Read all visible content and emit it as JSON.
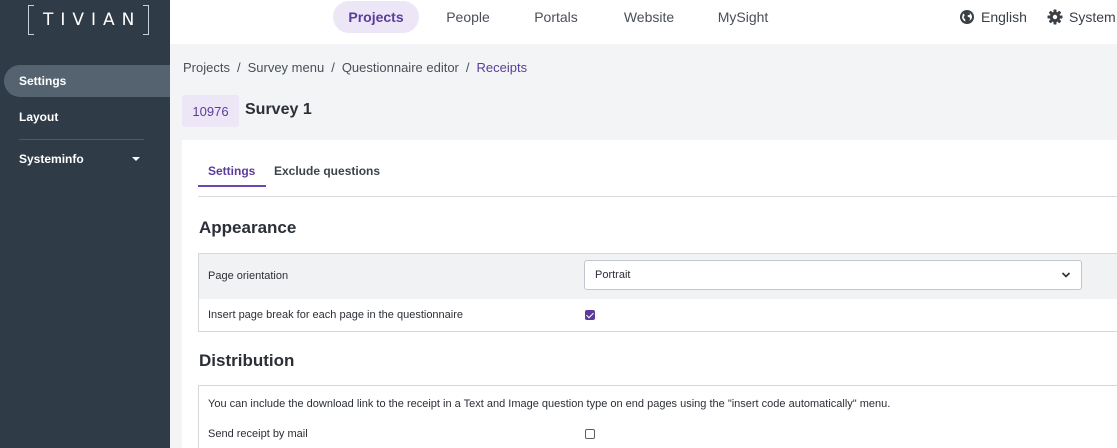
{
  "app": {
    "logo_text": "TIVIAN"
  },
  "sidebar": {
    "items": [
      {
        "label": "Settings",
        "active": true
      },
      {
        "label": "Layout",
        "active": false
      },
      {
        "label": "Systeminfo",
        "active": false,
        "has_dropdown": true
      }
    ]
  },
  "topnav": {
    "items": [
      {
        "label": "Projects",
        "active": true
      },
      {
        "label": "People",
        "active": false
      },
      {
        "label": "Portals",
        "active": false
      },
      {
        "label": "Website",
        "active": false
      },
      {
        "label": "MySight",
        "active": false
      }
    ],
    "language": {
      "label": "English",
      "icon": "globe-icon"
    },
    "system": {
      "label": "System",
      "icon": "gear-icon"
    }
  },
  "breadcrumb": [
    "Projects",
    "Survey menu",
    "Questionnaire editor",
    "Receipts"
  ],
  "survey": {
    "id": "10976",
    "title": "Survey 1"
  },
  "tabs": [
    {
      "label": "Settings",
      "active": true
    },
    {
      "label": "Exclude questions",
      "active": false
    }
  ],
  "appearance": {
    "title": "Appearance",
    "page_orientation": {
      "label": "Page orientation",
      "value": "Portrait"
    },
    "page_break": {
      "label": "Insert page break for each page in the questionnaire",
      "checked": true
    }
  },
  "distribution": {
    "title": "Distribution",
    "info": "You can include the download link to the receipt in a Text and Image question type on end pages using the \"insert code automatically\" menu.",
    "send_by_mail": {
      "label": "Send receipt by mail",
      "checked": false
    }
  },
  "colors": {
    "sidebar_bg": "#2f3b47",
    "sidebar_active": "#55626f",
    "accent": "#5b3c9a",
    "accent_light": "#ece6f7",
    "page_bg": "#f3f4f6"
  }
}
